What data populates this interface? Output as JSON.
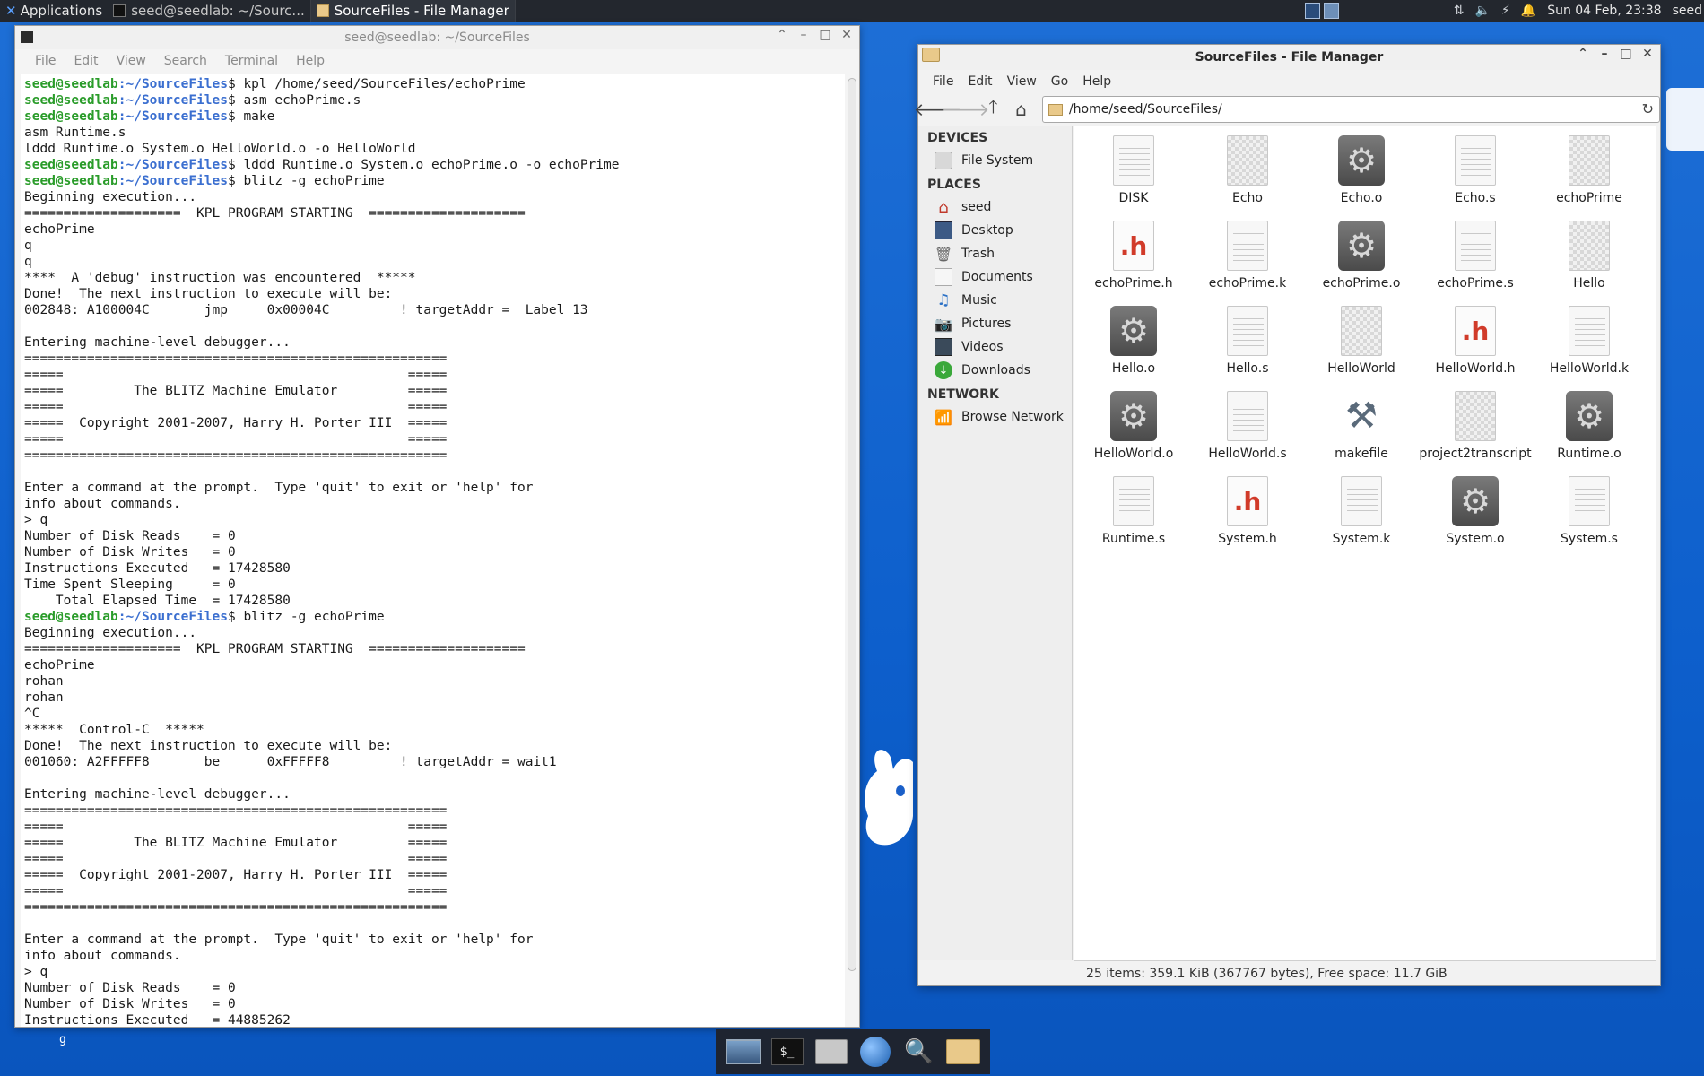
{
  "top_panel": {
    "applications_label": "Applications",
    "tasks": [
      {
        "label": "seed@seedlab: ~/Sourc...",
        "active": false
      },
      {
        "label": "SourceFiles - File Manager",
        "active": true
      }
    ],
    "clock": "Sun 04 Feb, 23:38",
    "user": "seed"
  },
  "terminal": {
    "title": "seed@seedlab: ~/SourceFiles",
    "menu": [
      "File",
      "Edit",
      "View",
      "Search",
      "Terminal",
      "Help"
    ],
    "prompt_user": "seed@seedlab",
    "prompt_path": ":~/SourceFiles",
    "lines": [
      {
        "prompt": true,
        "text": "$ kpl /home/seed/SourceFiles/echoPrime"
      },
      {
        "prompt": true,
        "text": "$ asm echoPrime.s"
      },
      {
        "prompt": true,
        "text": "$ make"
      },
      {
        "prompt": false,
        "text": "asm Runtime.s"
      },
      {
        "prompt": false,
        "text": "lddd Runtime.o System.o HelloWorld.o -o HelloWorld"
      },
      {
        "prompt": true,
        "text": "$ lddd Runtime.o System.o echoPrime.o -o echoPrime"
      },
      {
        "prompt": true,
        "text": "$ blitz -g echoPrime"
      },
      {
        "prompt": false,
        "text": "Beginning execution..."
      },
      {
        "prompt": false,
        "text": "====================  KPL PROGRAM STARTING  ===================="
      },
      {
        "prompt": false,
        "text": "echoPrime"
      },
      {
        "prompt": false,
        "text": "q"
      },
      {
        "prompt": false,
        "text": "q"
      },
      {
        "prompt": false,
        "text": "****  A 'debug' instruction was encountered  *****"
      },
      {
        "prompt": false,
        "text": "Done!  The next instruction to execute will be:"
      },
      {
        "prompt": false,
        "text": "002848: A100004C       jmp     0x00004C         ! targetAddr = _Label_13"
      },
      {
        "prompt": false,
        "text": ""
      },
      {
        "prompt": false,
        "text": "Entering machine-level debugger..."
      },
      {
        "prompt": false,
        "text": "======================================================"
      },
      {
        "prompt": false,
        "text": "=====                                            ====="
      },
      {
        "prompt": false,
        "text": "=====         The BLITZ Machine Emulator         ====="
      },
      {
        "prompt": false,
        "text": "=====                                            ====="
      },
      {
        "prompt": false,
        "text": "=====  Copyright 2001-2007, Harry H. Porter III  ====="
      },
      {
        "prompt": false,
        "text": "=====                                            ====="
      },
      {
        "prompt": false,
        "text": "======================================================"
      },
      {
        "prompt": false,
        "text": ""
      },
      {
        "prompt": false,
        "text": "Enter a command at the prompt.  Type 'quit' to exit or 'help' for"
      },
      {
        "prompt": false,
        "text": "info about commands."
      },
      {
        "prompt": false,
        "text": "> q"
      },
      {
        "prompt": false,
        "text": "Number of Disk Reads    = 0"
      },
      {
        "prompt": false,
        "text": "Number of Disk Writes   = 0"
      },
      {
        "prompt": false,
        "text": "Instructions Executed   = 17428580"
      },
      {
        "prompt": false,
        "text": "Time Spent Sleeping     = 0"
      },
      {
        "prompt": false,
        "text": "    Total Elapsed Time  = 17428580"
      },
      {
        "prompt": true,
        "text": "$ blitz -g echoPrime"
      },
      {
        "prompt": false,
        "text": "Beginning execution..."
      },
      {
        "prompt": false,
        "text": "====================  KPL PROGRAM STARTING  ===================="
      },
      {
        "prompt": false,
        "text": "echoPrime"
      },
      {
        "prompt": false,
        "text": "rohan"
      },
      {
        "prompt": false,
        "text": "rohan"
      },
      {
        "prompt": false,
        "text": "^C"
      },
      {
        "prompt": false,
        "text": "*****  Control-C  *****"
      },
      {
        "prompt": false,
        "text": "Done!  The next instruction to execute will be:"
      },
      {
        "prompt": false,
        "text": "001060: A2FFFFF8       be      0xFFFFF8         ! targetAddr = wait1"
      },
      {
        "prompt": false,
        "text": ""
      },
      {
        "prompt": false,
        "text": "Entering machine-level debugger..."
      },
      {
        "prompt": false,
        "text": "======================================================"
      },
      {
        "prompt": false,
        "text": "=====                                            ====="
      },
      {
        "prompt": false,
        "text": "=====         The BLITZ Machine Emulator         ====="
      },
      {
        "prompt": false,
        "text": "=====                                            ====="
      },
      {
        "prompt": false,
        "text": "=====  Copyright 2001-2007, Harry H. Porter III  ====="
      },
      {
        "prompt": false,
        "text": "=====                                            ====="
      },
      {
        "prompt": false,
        "text": "======================================================"
      },
      {
        "prompt": false,
        "text": ""
      },
      {
        "prompt": false,
        "text": "Enter a command at the prompt.  Type 'quit' to exit or 'help' for"
      },
      {
        "prompt": false,
        "text": "info about commands."
      },
      {
        "prompt": false,
        "text": "> q"
      },
      {
        "prompt": false,
        "text": "Number of Disk Reads    = 0"
      },
      {
        "prompt": false,
        "text": "Number of Disk Writes   = 0"
      },
      {
        "prompt": false,
        "text": "Instructions Executed   = 44885262"
      }
    ]
  },
  "file_manager": {
    "title": "SourceFiles - File Manager",
    "menu": [
      "File",
      "Edit",
      "View",
      "Go",
      "Help"
    ],
    "address": "/home/seed/SourceFiles/",
    "sidebar": {
      "devices_label": "DEVICES",
      "devices": [
        {
          "label": "File System",
          "icon": "drive-icon"
        }
      ],
      "places_label": "PLACES",
      "places": [
        {
          "label": "seed",
          "icon": "home-icon"
        },
        {
          "label": "Desktop",
          "icon": "desktop-icon"
        },
        {
          "label": "Trash",
          "icon": "trash-icon"
        },
        {
          "label": "Documents",
          "icon": "documents-icon"
        },
        {
          "label": "Music",
          "icon": "music-icon"
        },
        {
          "label": "Pictures",
          "icon": "pictures-icon"
        },
        {
          "label": "Videos",
          "icon": "videos-icon"
        },
        {
          "label": "Downloads",
          "icon": "downloads-icon"
        }
      ],
      "network_label": "NETWORK",
      "network": [
        {
          "label": "Browse Network",
          "icon": "network-icon"
        }
      ]
    },
    "files": [
      {
        "name": "DISK",
        "kind": "doc"
      },
      {
        "name": "Echo",
        "kind": "checker"
      },
      {
        "name": "Echo.o",
        "kind": "gear"
      },
      {
        "name": "Echo.s",
        "kind": "doc"
      },
      {
        "name": "echoPrime",
        "kind": "checker"
      },
      {
        "name": "echoPrime.h",
        "kind": "header"
      },
      {
        "name": "echoPrime.k",
        "kind": "doc"
      },
      {
        "name": "echoPrime.o",
        "kind": "gear"
      },
      {
        "name": "echoPrime.s",
        "kind": "doc"
      },
      {
        "name": "Hello",
        "kind": "checker"
      },
      {
        "name": "Hello.o",
        "kind": "gear"
      },
      {
        "name": "Hello.s",
        "kind": "doc"
      },
      {
        "name": "HelloWorld",
        "kind": "checker"
      },
      {
        "name": "HelloWorld.h",
        "kind": "header"
      },
      {
        "name": "HelloWorld.k",
        "kind": "doc"
      },
      {
        "name": "HelloWorld.o",
        "kind": "gear"
      },
      {
        "name": "HelloWorld.s",
        "kind": "doc"
      },
      {
        "name": "makefile",
        "kind": "make"
      },
      {
        "name": "project2transcript",
        "kind": "checker"
      },
      {
        "name": "Runtime.o",
        "kind": "gear"
      },
      {
        "name": "Runtime.s",
        "kind": "doc"
      },
      {
        "name": "System.h",
        "kind": "header"
      },
      {
        "name": "System.k",
        "kind": "doc"
      },
      {
        "name": "System.o",
        "kind": "gear"
      },
      {
        "name": "System.s",
        "kind": "doc"
      }
    ],
    "status": "25 items: 359.1 KiB (367767 bytes), Free space: 11.7 GiB"
  },
  "dock": {
    "items": [
      "desktop-icon",
      "terminal-icon",
      "home-folder-icon",
      "web-browser-icon",
      "search-icon",
      "folder-icon"
    ],
    "terminal_glyph": "$_"
  },
  "desktop_stray_char": "g"
}
